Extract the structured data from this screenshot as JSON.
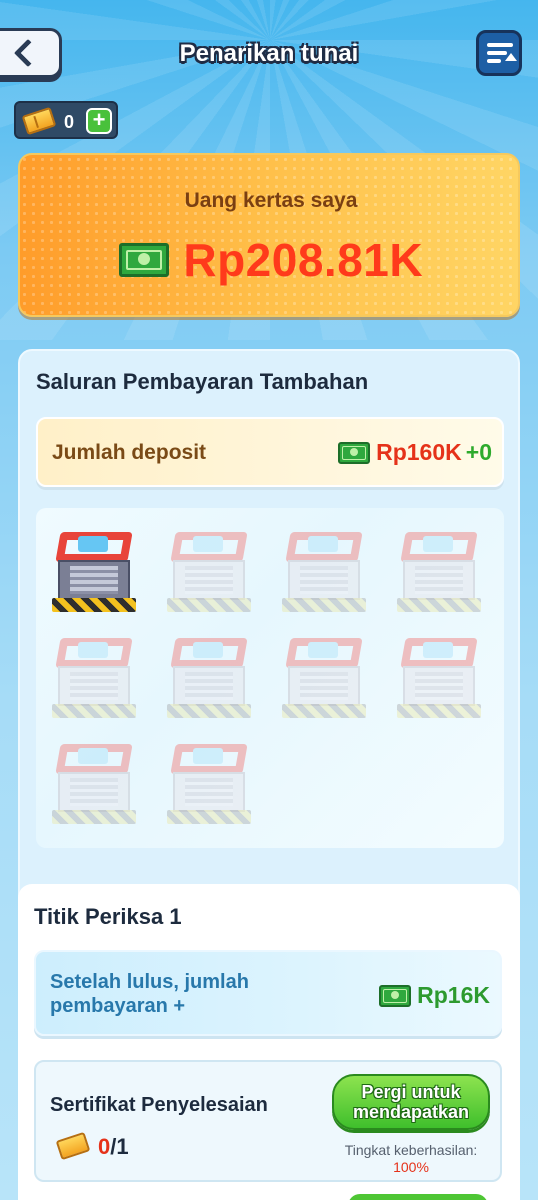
{
  "header": {
    "title": "Penarikan tunai",
    "back_icon": "chevron-left-icon",
    "menu_icon": "list-upload-icon"
  },
  "coupon": {
    "icon": "coupon-ticket-icon",
    "count": "0",
    "add_label": "+"
  },
  "balance": {
    "label": "Uang kertas saya",
    "icon": "banknote-icon",
    "amount": "Rp208.81K"
  },
  "payment_channel": {
    "title": "Saluran Pembayaran Tambahan",
    "deposit_label": "Jumlah deposit",
    "deposit_amount": "Rp160K",
    "deposit_plus": "+0",
    "shops": [
      {
        "state": "active"
      },
      {
        "state": "locked"
      },
      {
        "state": "locked"
      },
      {
        "state": "locked"
      },
      {
        "state": "locked"
      },
      {
        "state": "locked"
      },
      {
        "state": "locked"
      },
      {
        "state": "locked"
      },
      {
        "state": "locked"
      },
      {
        "state": "locked"
      }
    ]
  },
  "checkpoint": {
    "title": "Titik Periksa 1",
    "bonus_label": "Setelah lulus, jumlah pembayaran +",
    "bonus_amount": "Rp16K",
    "certificate_label": "Sertifikat Penyelesaian",
    "certificate_current": "0",
    "certificate_total": "/1",
    "get_button": "Pergi untuk mendapatkan",
    "success_rate_label": "Tingkat keberhasilan:",
    "success_rate_value": "100%"
  },
  "colors": {
    "accent_red": "#ff3a1b",
    "accent_green": "#3fbf2c",
    "panel_blue": "#dcf1fd"
  }
}
